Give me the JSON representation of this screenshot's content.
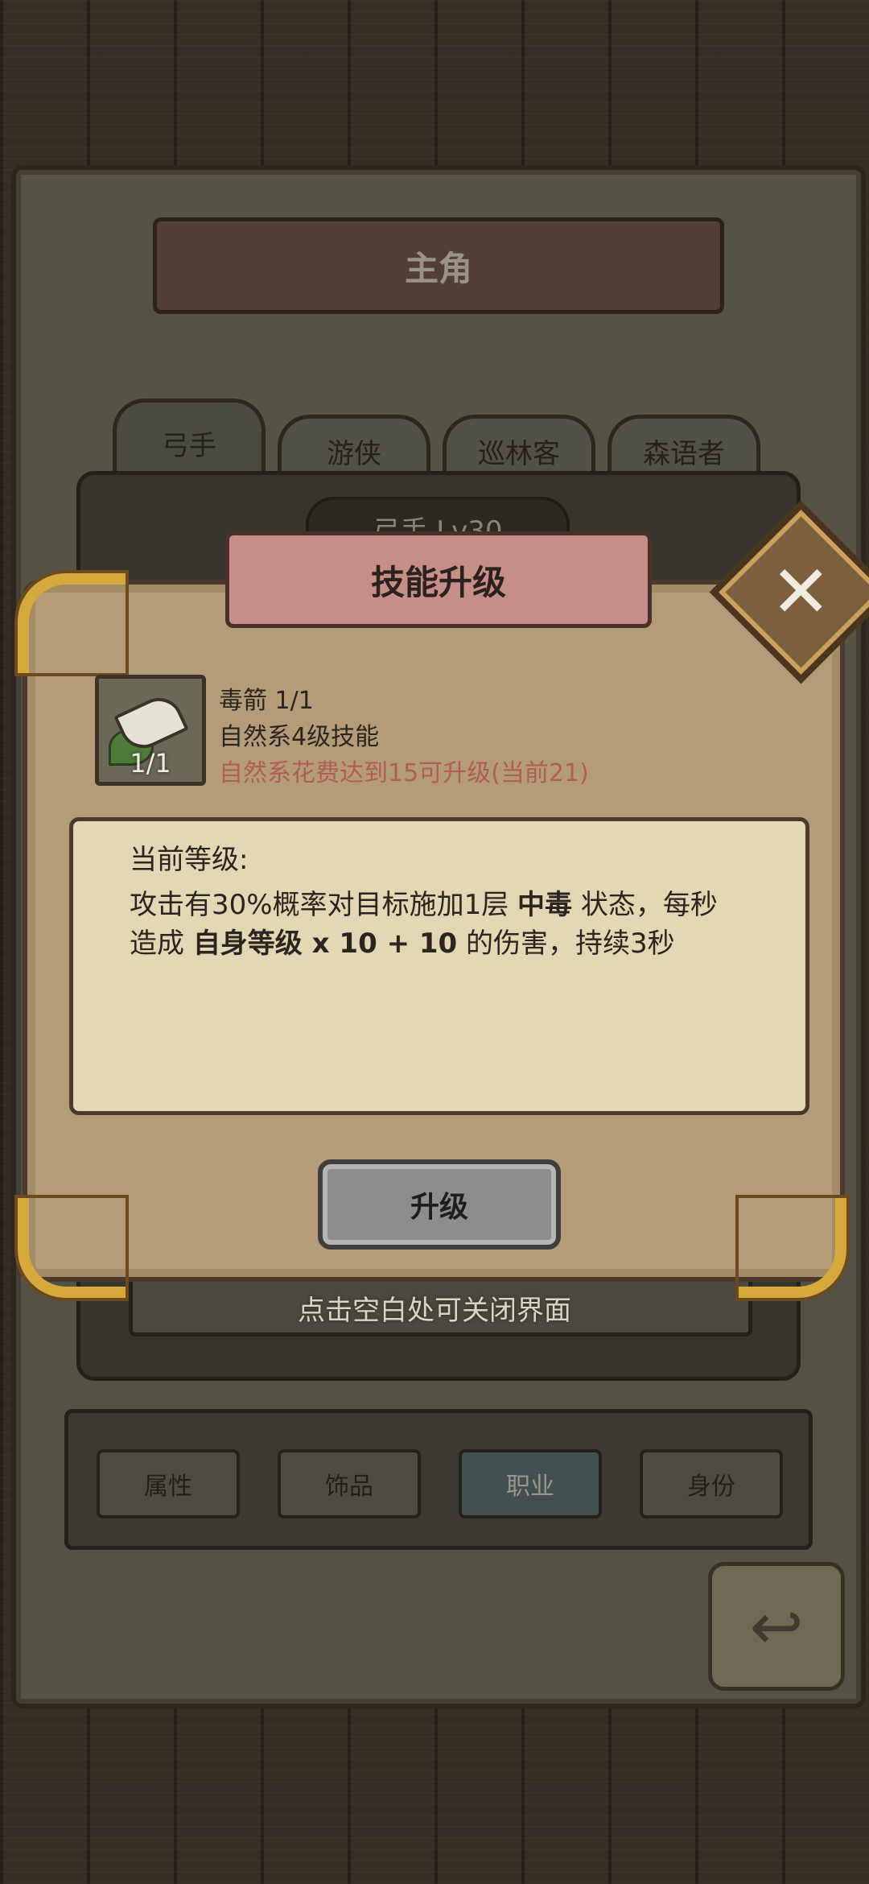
{
  "screen": {
    "title": "主角",
    "tabs": [
      "弓手",
      "游侠",
      "巡林客",
      "森语者"
    ],
    "level_label": "弓手 Lv30",
    "close_hint": "点击空白处可关闭界面",
    "bottom_nav": [
      "属性",
      "饰品",
      "职业",
      "身份"
    ],
    "active_nav": "职业"
  },
  "modal": {
    "title": "技能升级",
    "close_icon": "close-icon",
    "skill": {
      "icon": "poison-arrow-icon",
      "count": "1/1",
      "name": "毒箭 1/1",
      "type": "自然系4级技能",
      "requirement": "自然系花费达到15可升级(当前21)"
    },
    "desc": {
      "title": "当前等级:",
      "line1_pre": "攻击有30%概率对目标施加1层 ",
      "line1_kw": "中毒",
      "line1_post": " 状态，每秒",
      "line2_pre": "造成 ",
      "line2_kw": "自身等级",
      "line2_formula": " x 10 + 10",
      "line2_post": " 的伤害，持续3秒"
    },
    "upgrade_button": "升级"
  },
  "colors": {
    "requirement_text": "#b06052",
    "modal_bg": "#b59c78",
    "gold_corner": "#d6a93c",
    "active_nav": "#5f7378"
  }
}
